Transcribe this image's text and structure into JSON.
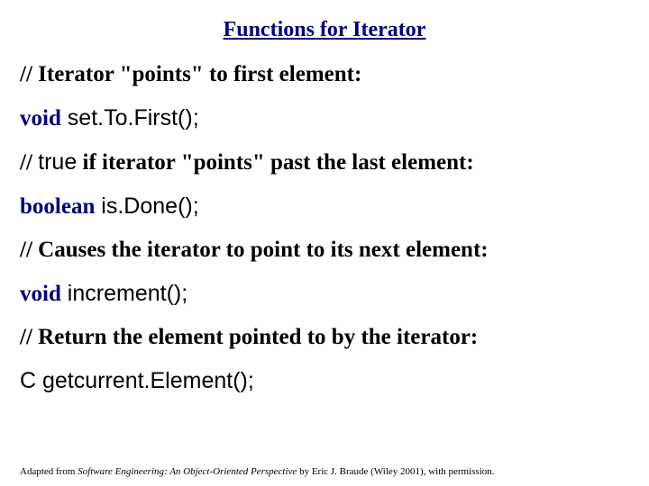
{
  "title": "Functions for Iterator",
  "lines": {
    "c1_prefix": "// ",
    "c1_text": "Iterator \"points\" to first element:",
    "m1_kw": "void",
    "m1_name": " set.To.First();",
    "c2_prefix": "// ",
    "c2_true": "true",
    "c2_text": " if iterator \"points\" past the last element:",
    "m2_kw": "boolean",
    "m2_name": " is.Done();",
    "c3_prefix": "// ",
    "c3_text": "Causes the iterator to point to its next element:",
    "m3_kw": "void",
    "m3_name": " increment();",
    "c4_prefix": "// ",
    "c4_text": "Return the element pointed to by the iterator:",
    "m4_name": "C getcurrent.Element();"
  },
  "attribution": {
    "prefix": "Adapted from ",
    "book": "Software Engineering: An Object-Oriented Perspective",
    "suffix": " by Eric J. Braude (Wiley 2001), with permission."
  }
}
